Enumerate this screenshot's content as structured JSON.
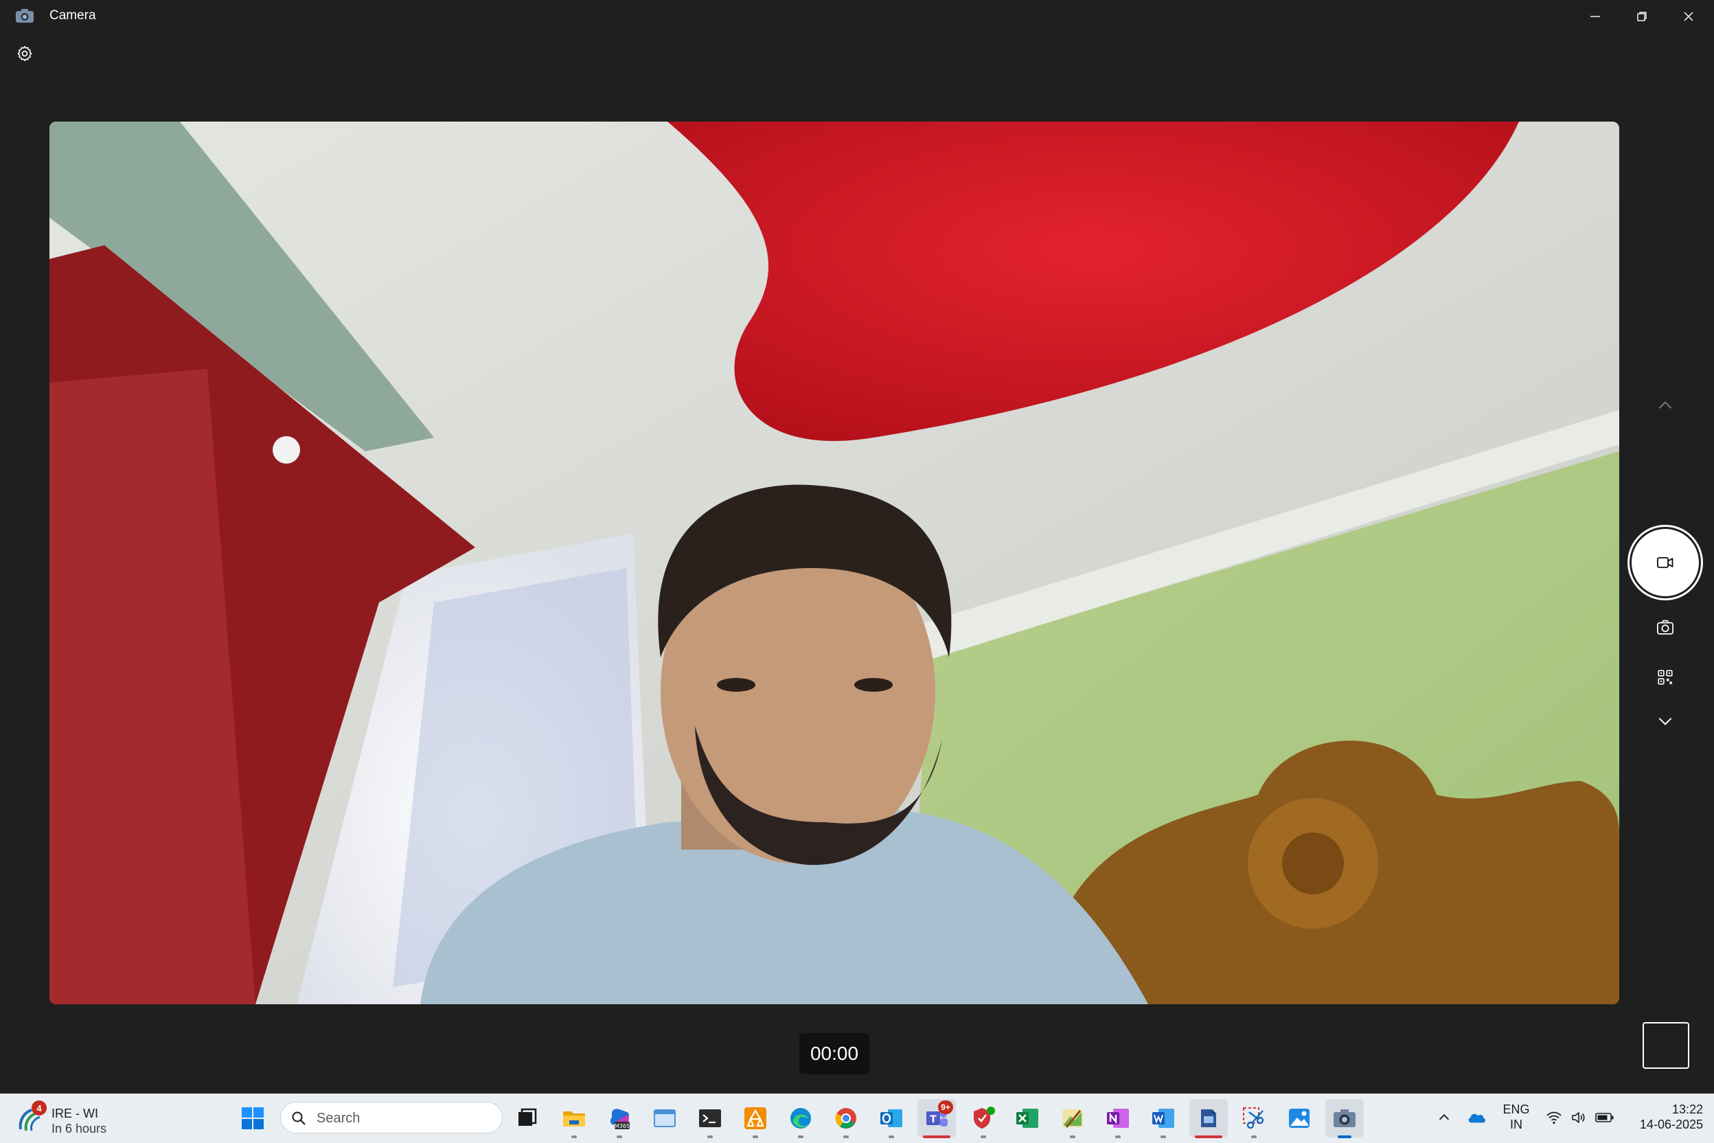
{
  "window": {
    "title": "Camera",
    "icons": {
      "app": "camera-icon",
      "minimize": "minimize-icon",
      "maximize": "maximize-icon",
      "close": "close-icon",
      "settings": "gear-icon"
    }
  },
  "controls": {
    "timer": "00:00",
    "icons": [
      "chevron-up-icon",
      "video-icon",
      "photo-camera-icon",
      "qr-code-icon",
      "chevron-down-icon"
    ]
  },
  "taskbar": {
    "weather": {
      "badge": "4",
      "title": "IRE - WI",
      "subtitle": "In 6 hours"
    },
    "search": {
      "placeholder": "Search"
    },
    "apps": [
      {
        "name": "start"
      },
      {
        "name": "task-view"
      },
      {
        "name": "file-explorer"
      },
      {
        "name": "microsoft-365"
      },
      {
        "name": "window-app"
      },
      {
        "name": "terminal"
      },
      {
        "name": "orange-app"
      },
      {
        "name": "edge"
      },
      {
        "name": "chrome"
      },
      {
        "name": "outlook"
      },
      {
        "name": "teams",
        "badge": "9+"
      },
      {
        "name": "security"
      },
      {
        "name": "excel"
      },
      {
        "name": "paint"
      },
      {
        "name": "onenote"
      },
      {
        "name": "word"
      },
      {
        "name": "print-app"
      },
      {
        "name": "snipping-tool"
      },
      {
        "name": "photos"
      },
      {
        "name": "camera"
      }
    ],
    "tray": {
      "lang_line1": "ENG",
      "lang_line2": "IN",
      "time": "13:22",
      "date": "14-06-2025"
    }
  },
  "colors": {
    "accent": "#0067c0",
    "background": "#1f1f1f",
    "taskbar": "#e9eef2",
    "alert": "#c42b1c"
  }
}
